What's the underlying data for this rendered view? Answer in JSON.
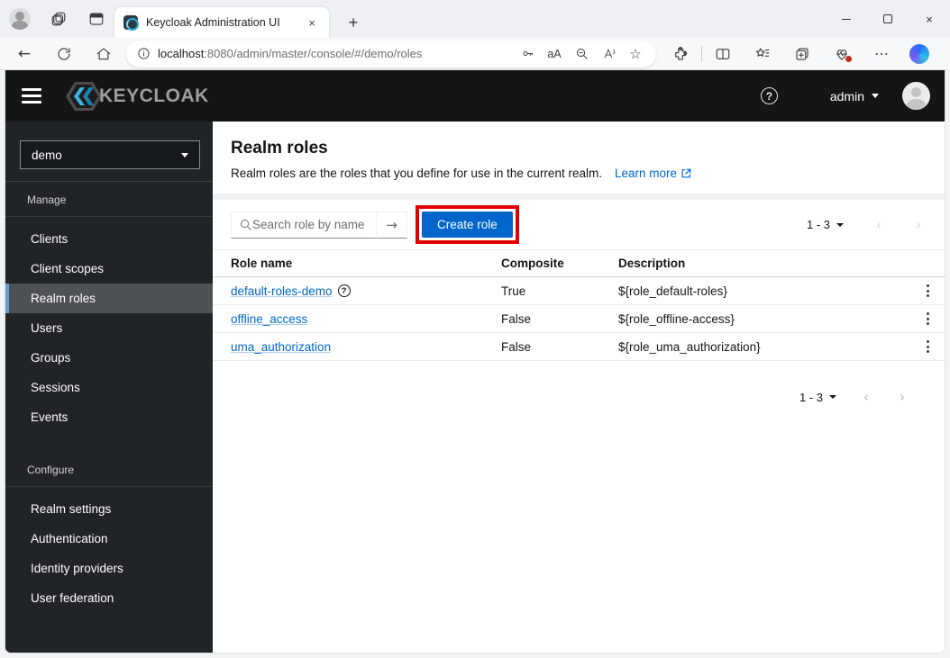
{
  "browser": {
    "tab": {
      "title": "Keycloak Administration UI",
      "close": "×"
    },
    "new_tab": "+",
    "address": {
      "host": "localhost",
      "rest": ":8080/admin/master/console/#/demo/roles"
    },
    "window_close": "×"
  },
  "app_header": {
    "brand": "KEYCLOAK",
    "help": "?",
    "user": "admin"
  },
  "sidebar": {
    "realm_select": "demo",
    "manage": {
      "label": "Manage",
      "items": [
        {
          "label": "Clients"
        },
        {
          "label": "Client scopes"
        },
        {
          "label": "Realm roles"
        },
        {
          "label": "Users"
        },
        {
          "label": "Groups"
        },
        {
          "label": "Sessions"
        },
        {
          "label": "Events"
        }
      ]
    },
    "configure": {
      "label": "Configure",
      "items": [
        {
          "label": "Realm settings"
        },
        {
          "label": "Authentication"
        },
        {
          "label": "Identity providers"
        },
        {
          "label": "User federation"
        }
      ]
    }
  },
  "main": {
    "title": "Realm roles",
    "description": "Realm roles are the roles that you define for use in the current realm.",
    "learn_more_label": "Learn more",
    "toolbar": {
      "search_placeholder": "Search role by name",
      "search_submit": "→",
      "create_button_label": "Create role"
    },
    "pagination": {
      "range": "1 - 3",
      "prev": "‹",
      "next": "›",
      "help": "?"
    },
    "table": {
      "columns": [
        "Role name",
        "Composite",
        "Description"
      ],
      "rows": [
        {
          "name": "default-roles-demo",
          "composite": "True",
          "description": "${role_default-roles}"
        },
        {
          "name": "offline_access",
          "composite": "False",
          "description": "${role_offline-access}"
        },
        {
          "name": "uma_authorization",
          "composite": "False",
          "description": "${role_uma_authorization}"
        }
      ]
    }
  },
  "colors": {
    "primary_button": "#0066cc",
    "link": "#0066cc",
    "annotation_box": "#e00000",
    "header_bg": "#151515",
    "sidebar_bg": "#212427",
    "nav_active_bg": "#4f5255",
    "nav_active_border": "#639fd2"
  }
}
